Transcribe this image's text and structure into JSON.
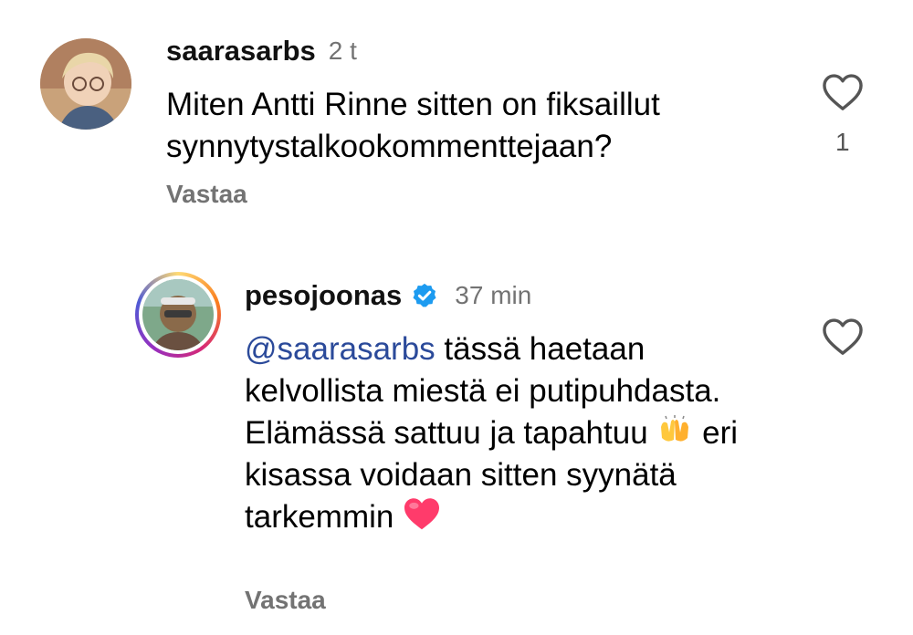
{
  "comments": [
    {
      "username": "saarasarbs",
      "time": "2 t",
      "text": "Miten Antti Rinne sitten on fiksaillut synnytystalkookommenttejaan?",
      "reply_label": "Vastaa",
      "like_count": "1",
      "avatar_icon": "user-avatar-photo"
    },
    {
      "username": "pesojoonas",
      "verified": true,
      "time": "37 min",
      "mention": "@saarasarbs",
      "text_part1": "tässä haetaan kelvollista miestä ei putipuhdasta. Elämässä sattuu ja tapahtuu",
      "emoji1": "raising-hands-emoji",
      "text_part2": "eri kisassa voidaan sitten syynätä tarkemmin",
      "emoji2": "red-heart-emoji",
      "reply_label": "Vastaa",
      "avatar_icon": "user-avatar-photo-story-ring"
    }
  ],
  "colors": {
    "secondary_text": "#737373",
    "mention": "#2b4a9a",
    "verified_badge": "#1d9bf0",
    "heart_emoji": "#ff3b6b"
  }
}
